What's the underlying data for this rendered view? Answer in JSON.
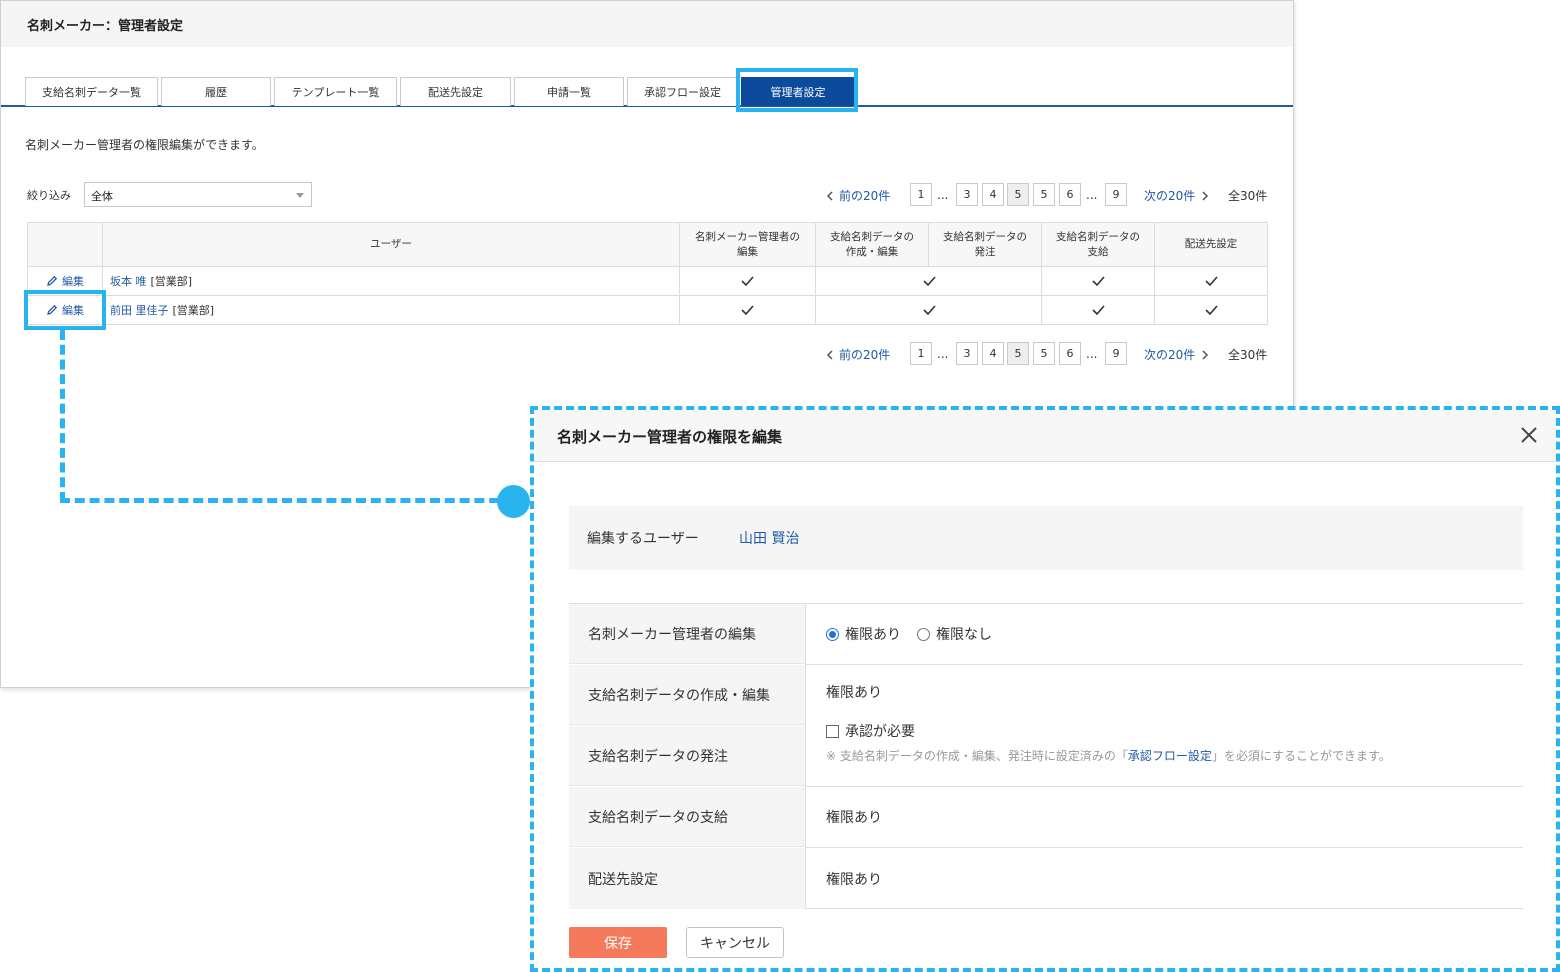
{
  "app": {
    "title": "名刺メーカー：管理者設定",
    "tabs": [
      "支給名刺データ一覧",
      "履歴",
      "テンプレート一覧",
      "配送先設定",
      "申請一覧",
      "承認フロー設定",
      "管理者設定"
    ],
    "active_tab": "管理者設定",
    "description": "名刺メーカー管理者の権限編集ができます。",
    "filter": {
      "label": "絞り込み",
      "value": "全体"
    },
    "pager": {
      "prev": "前の20件",
      "next": "次の20件",
      "pages": [
        "1",
        "3",
        "4",
        "5",
        "5",
        "6",
        "9"
      ],
      "ellipsis": "...",
      "current_page": "5",
      "total": "全30件"
    },
    "table": {
      "headers": [
        "ユーザー",
        "名刺メーカー管理者の\n編集",
        "支給名刺データの\n作成・編集",
        "支給名刺データの\n発注",
        "支給名刺データの\n支給",
        "配送先設定"
      ],
      "edit_label": "編集",
      "rows": [
        {
          "name": "坂本 唯",
          "dept": "[営業部]"
        },
        {
          "name": "前田 里佳子",
          "dept": "[営業部]"
        }
      ]
    }
  },
  "modal": {
    "title": "名刺メーカー管理者の権限を編集",
    "target_label": "編集するユーザー",
    "target_user": "山田 賢治",
    "rows": {
      "admin_edit": "名刺メーカー管理者の編集",
      "create_edit": "支給名刺データの作成・編集",
      "order": "支給名刺データの発注",
      "supply": "支給名刺データの支給",
      "shipping": "配送先設定"
    },
    "radio_yes": "権限あり",
    "radio_no": "権限なし",
    "has_permission": "権限あり",
    "approval_required": "承認が必要",
    "note_prefix": "※ 支給名刺データの作成・編集、発注時に設定済みの「",
    "note_link": "承認フロー設定",
    "note_suffix": "」を必須にすることができます。",
    "save": "保存",
    "cancel": "キャンセル"
  },
  "colors": {
    "highlight": "#2ab4ef",
    "tab_active": "#0b4a9c",
    "link": "#1f5aa6",
    "save": "#f5795b"
  },
  "icons": [
    "pencil-icon",
    "check-icon",
    "close-icon",
    "chevron-left-icon",
    "chevron-right-icon"
  ]
}
